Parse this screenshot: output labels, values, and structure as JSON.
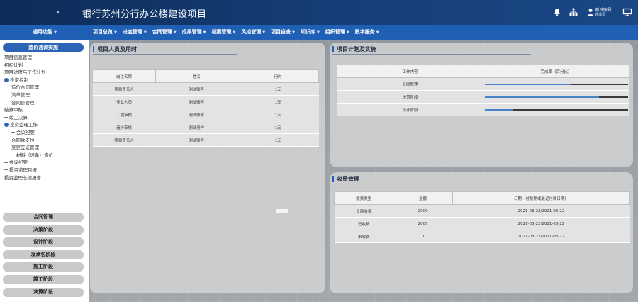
{
  "header": {
    "title": "银行苏州分行办公楼建设项目",
    "user_name": "测试账号",
    "user_role": "管理员"
  },
  "nav": {
    "main": "通用功能",
    "items": [
      "项目总览",
      "进度管理",
      "合同管理",
      "成果管理",
      "档案管理",
      "风控管理",
      "项目自查",
      "知识库",
      "组织管理",
      "数字服务"
    ]
  },
  "sidebar": {
    "head": "造价咨询实施",
    "tree": [
      {
        "label": "项目信息管理",
        "level": 0,
        "marker": "none"
      },
      {
        "label": "招标计划",
        "level": 0,
        "marker": "none"
      },
      {
        "label": "项目进度与工作计划",
        "level": 0,
        "marker": "none"
      },
      {
        "label": "投资控制",
        "level": 0,
        "marker": "dot"
      },
      {
        "label": "造价合同管理",
        "level": 1,
        "marker": "none"
      },
      {
        "label": "清单管理",
        "level": 1,
        "marker": "none"
      },
      {
        "label": "合同价管理",
        "level": 1,
        "marker": "none"
      },
      {
        "label": "结算审核",
        "level": 0,
        "marker": "none"
      },
      {
        "label": "竣工决算",
        "level": 0,
        "marker": "line"
      },
      {
        "label": "投资监理工作",
        "level": 0,
        "marker": "dot"
      },
      {
        "label": "会议纪要",
        "level": 1,
        "marker": "line"
      },
      {
        "label": "合同款支付",
        "level": 1,
        "marker": "none"
      },
      {
        "label": "变更签证管理",
        "level": 1,
        "marker": "none"
      },
      {
        "label": "材料（设备）询价",
        "level": 1,
        "marker": "line"
      },
      {
        "label": "会议纪要",
        "level": 0,
        "marker": "line"
      },
      {
        "label": "投资监理月报",
        "level": 0,
        "marker": "line"
      },
      {
        "label": "投资监理总结报告",
        "level": 0,
        "marker": "none"
      }
    ],
    "buttons": [
      "合同管理",
      "决策阶段",
      "设计阶段",
      "发承包阶段",
      "施工阶段",
      "竣工阶段",
      "决算阶段"
    ]
  },
  "staff_panel": {
    "title": "项目人员及用时",
    "columns": [
      "岗位名称",
      "姓名",
      "用时"
    ],
    "rows": [
      [
        "项目负责人",
        "测试账号",
        "1天"
      ],
      [
        "专业人员",
        "测试账号",
        "1天"
      ],
      [
        "工程审核",
        "测试账号",
        "1天"
      ],
      [
        "造价审核",
        "测试用户",
        "1天"
      ],
      [
        "项目负责人",
        "测试账号",
        "1天"
      ]
    ]
  },
  "plan_panel": {
    "title": "项目计划及实施",
    "columns": [
      "工作内容",
      "完成率（百分比）"
    ],
    "rows": [
      {
        "label": "合同管理",
        "progress": 0.6
      },
      {
        "label": "决策阶段",
        "progress": 0.8
      },
      {
        "label": "设计阶段",
        "progress": 0.2
      }
    ]
  },
  "fee_panel": {
    "title": "收费管理",
    "columns": [
      "收费类型",
      "金额",
      "日期（付款期或最近付款日期）"
    ],
    "rows": [
      [
        "合同收费",
        "2000",
        "2021-03-22/2021-03-22"
      ],
      [
        "已收费",
        "2000",
        "2021-03-22/2021-03-22"
      ],
      [
        "未收费",
        "0",
        "2021-03-22/2021-03-22"
      ]
    ]
  }
}
